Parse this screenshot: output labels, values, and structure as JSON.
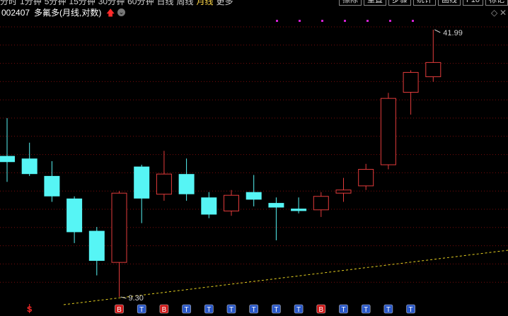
{
  "toolbar": {
    "left_items": [
      "分时",
      "1分钟",
      "5分钟",
      "15分钟",
      "30分钟",
      "60分钟",
      "日线",
      "周线",
      "月线",
      "更多"
    ],
    "active": "月线",
    "right_items": [
      "擦除",
      "重置",
      "步骤",
      "统计",
      "画线",
      "F10",
      "标记"
    ]
  },
  "header": {
    "code": "002407",
    "name": "多氟多(月线,对数)",
    "arrow_icon": "red-up-arrow",
    "circle_icon": "chevron-down-circle"
  },
  "chart_data": {
    "type": "candlestick",
    "scale": "log",
    "up_color": "#e23b3b",
    "down_color": "#56f5f5",
    "candles": [
      {
        "open": 20.6,
        "high": 25.5,
        "low": 17.8,
        "close": 19.9
      },
      {
        "open": 20.3,
        "high": 22.2,
        "low": 18.4,
        "close": 18.6
      },
      {
        "open": 18.4,
        "high": 20.0,
        "low": 15.9,
        "close": 16.4
      },
      {
        "open": 16.2,
        "high": 16.4,
        "low": 12.6,
        "close": 13.4
      },
      {
        "open": 13.5,
        "high": 13.8,
        "low": 10.5,
        "close": 11.4
      },
      {
        "open": 11.3,
        "high": 16.9,
        "low": 9.3,
        "close": 16.7
      },
      {
        "open": 19.4,
        "high": 19.6,
        "low": 14.1,
        "close": 16.2
      },
      {
        "open": 16.6,
        "high": 21.2,
        "low": 16.0,
        "close": 18.6
      },
      {
        "open": 18.6,
        "high": 20.3,
        "low": 16.0,
        "close": 16.6
      },
      {
        "open": 16.3,
        "high": 16.8,
        "low": 14.5,
        "close": 14.8
      },
      {
        "open": 15.1,
        "high": 17.0,
        "low": 14.7,
        "close": 16.5
      },
      {
        "open": 16.8,
        "high": 18.5,
        "low": 15.5,
        "close": 16.1
      },
      {
        "open": 15.8,
        "high": 16.3,
        "low": 12.8,
        "close": 15.4
      },
      {
        "open": 15.3,
        "high": 16.3,
        "low": 14.9,
        "close": 15.1
      },
      {
        "open": 15.2,
        "high": 16.8,
        "low": 14.6,
        "close": 16.4
      },
      {
        "open": 16.7,
        "high": 18.2,
        "low": 15.9,
        "close": 17.0
      },
      {
        "open": 17.4,
        "high": 19.7,
        "low": 17.0,
        "close": 19.1
      },
      {
        "open": 19.6,
        "high": 29.4,
        "low": 19.1,
        "close": 28.5
      },
      {
        "open": 29.5,
        "high": 33.4,
        "low": 26.0,
        "close": 33.0
      },
      {
        "open": 32.2,
        "high": 41.99,
        "low": 31.3,
        "close": 34.9
      }
    ],
    "high_label": "41.99",
    "low_label": "9.30",
    "markers": [
      "",
      "S",
      "",
      "",
      "",
      "B",
      "T",
      "B",
      "T",
      "T",
      "T",
      "T",
      "T",
      "T",
      "B",
      "T",
      "T",
      "T",
      "T",
      ""
    ]
  }
}
